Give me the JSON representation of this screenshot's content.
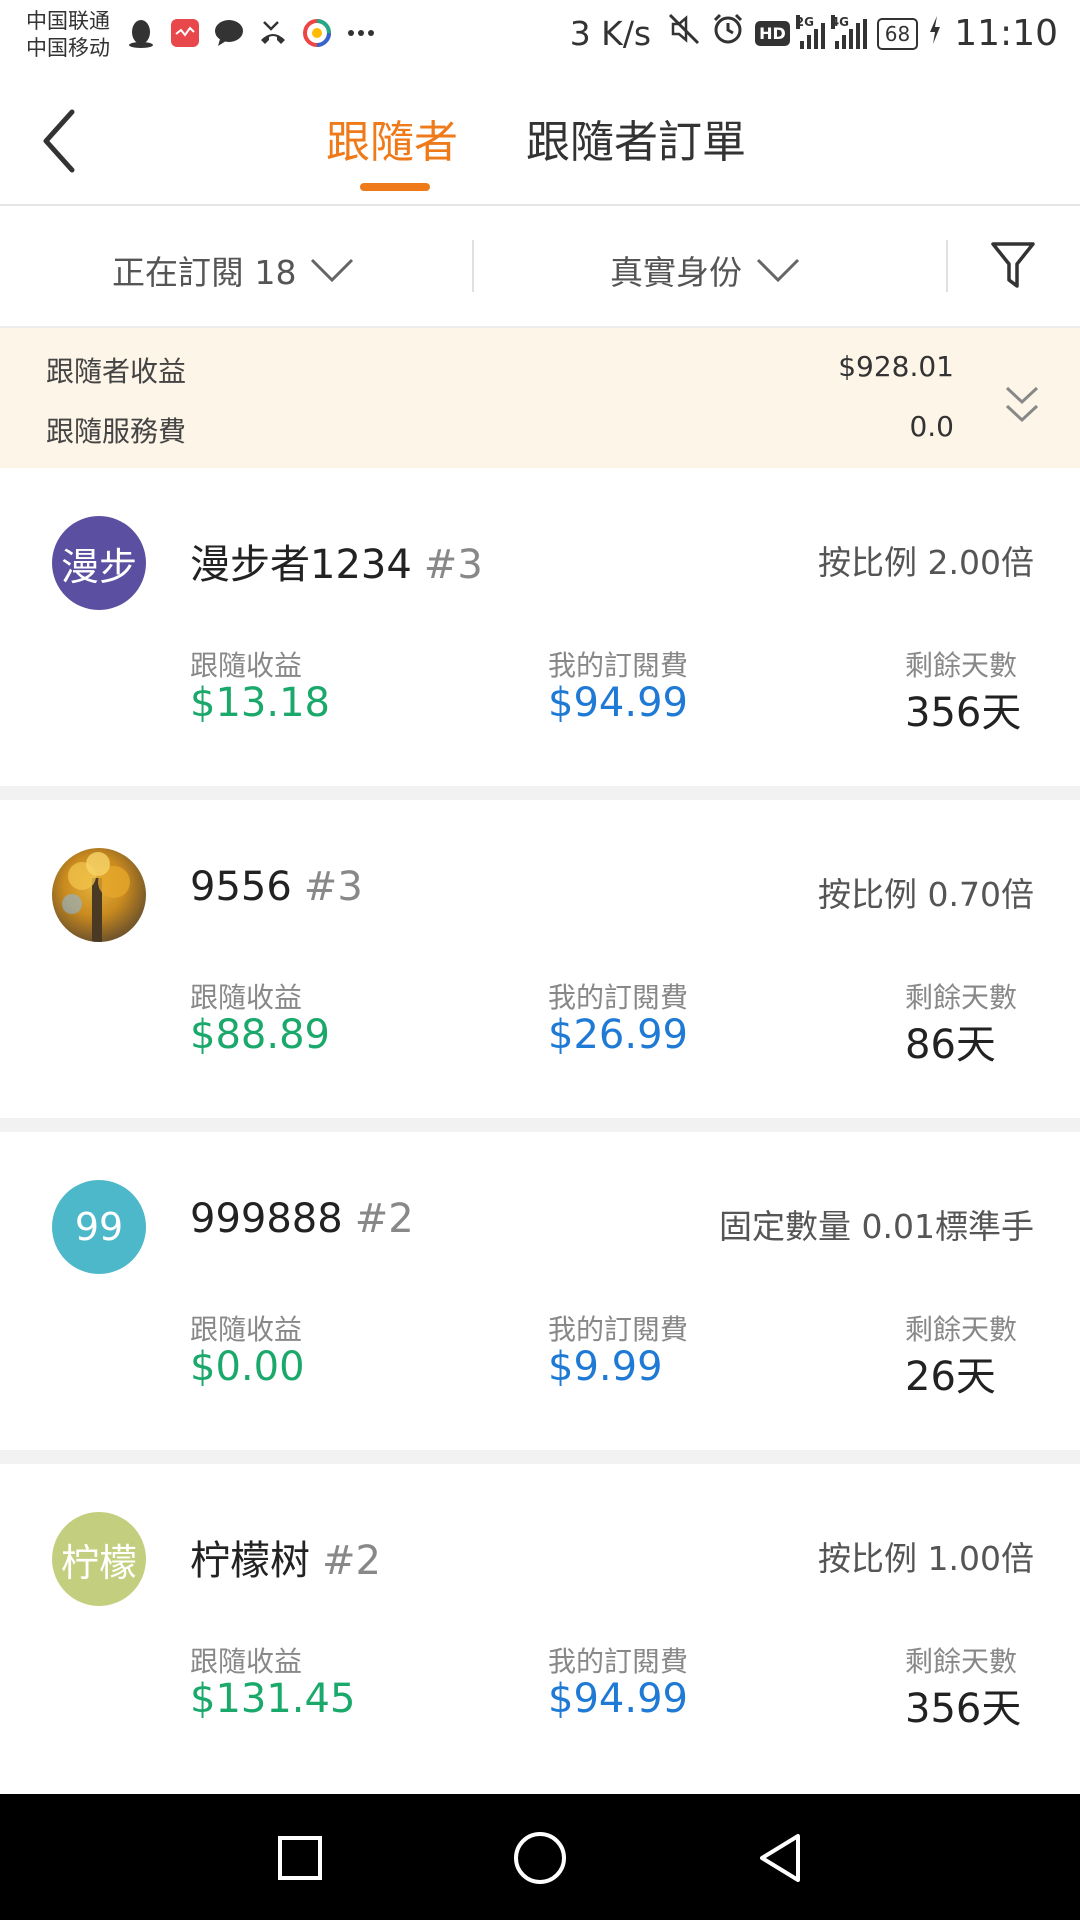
{
  "status_bar": {
    "carrier1": "中国联通",
    "carrier2": "中国移动",
    "left_icons": [
      "qq-icon",
      "app-icon",
      "chat-icon",
      "missed-call-icon",
      "browser-icon",
      "more-icon"
    ],
    "speed": "3 K/s",
    "hd": "HD",
    "net1": "2G",
    "net2": "4G",
    "battery": "68",
    "time": "11:10"
  },
  "header": {
    "tabs": [
      {
        "label": "跟隨者",
        "active": true
      },
      {
        "label": "跟隨者訂單",
        "active": false
      }
    ]
  },
  "filters": {
    "subscription": "正在訂閱 18",
    "identity": "真實身份"
  },
  "summary": {
    "earnings_label": "跟隨者收益",
    "earnings_value": "$928.01",
    "fee_label": "跟隨服務費",
    "fee_value": "0.0"
  },
  "followers": [
    {
      "avatar_text": "漫步",
      "avatar_color": "#5b4fa1",
      "name": "漫步者1234",
      "rank": "#3",
      "mode": "按比例 2.00倍",
      "earnings_label": "跟隨收益",
      "earnings": "$13.18",
      "fee_label": "我的訂閱費",
      "fee": "$94.99",
      "days_label": "剩餘天數",
      "days": "356天"
    },
    {
      "avatar_text": "",
      "avatar_color": "",
      "name": "9556",
      "rank": "#3",
      "mode": "按比例 0.70倍",
      "earnings_label": "跟隨收益",
      "earnings": "$88.89",
      "fee_label": "我的訂閱費",
      "fee": "$26.99",
      "days_label": "剩餘天數",
      "days": "86天"
    },
    {
      "avatar_text": "99",
      "avatar_color": "#4db8c9",
      "name": "999888",
      "rank": "#2",
      "mode": "固定數量 0.01標準手",
      "earnings_label": "跟隨收益",
      "earnings": "$0.00",
      "fee_label": "我的訂閱費",
      "fee": "$9.99",
      "days_label": "剩餘天數",
      "days": "26天"
    },
    {
      "avatar_text": "柠檬",
      "avatar_color": "#c3cf7f",
      "name": "柠檬树",
      "rank": "#2",
      "mode": "按比例 1.00倍",
      "earnings_label": "跟隨收益",
      "earnings": "$131.45",
      "fee_label": "我的訂閱費",
      "fee": "$94.99",
      "days_label": "剩餘天數",
      "days": "356天"
    }
  ],
  "colors": {
    "accent": "#ef7a1a",
    "earnings_green": "#1aa86b",
    "fee_blue": "#1f7ad6",
    "summary_bg": "#fdf5e8"
  }
}
